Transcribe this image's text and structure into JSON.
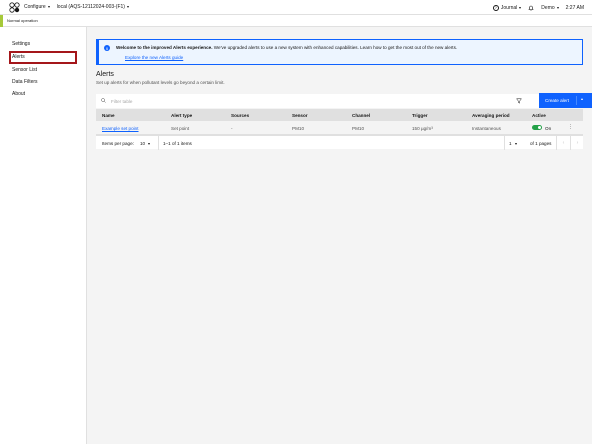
{
  "topbar": {
    "logo": "app-logo",
    "menu_configure": "Configure",
    "menu_device": "local (AQS-12112024-003-(F1)",
    "journal": "Journal",
    "user": "Demo",
    "time": "2:27 AM"
  },
  "status": {
    "text": "Normal operation",
    "accent_color": "#a6c93a"
  },
  "sidebar": {
    "items": [
      {
        "label": "Settings"
      },
      {
        "label": "Alerts"
      },
      {
        "label": "Sensor List"
      },
      {
        "label": "Data Filters"
      },
      {
        "label": "About"
      }
    ],
    "highlight_color": "#a4161a"
  },
  "notice": {
    "title": "Welcome to the improved Alerts experience.",
    "body": "We've upgraded alerts to use a new system with enhanced capabilities. Learn how to get the most out of the new alerts.",
    "link": "Explore the new Alerts guide"
  },
  "alerts": {
    "title": "Alerts",
    "subtitle": "Set up alerts for when pollutant levels go beyond a certain limit.",
    "search_placeholder": "Filter table",
    "create_button": "Create alert",
    "columns": [
      "Name",
      "Alert type",
      "Sources",
      "Sensor",
      "Channel",
      "Trigger",
      "Averaging period",
      "Active"
    ],
    "rows": [
      {
        "name": "Example set point",
        "alert_type": "Set point",
        "sources": "-",
        "sensor": "PM10",
        "channel": "PM10",
        "trigger": "150 µg/m³",
        "averaging_period": "Instantaneous",
        "active": "On"
      }
    ]
  },
  "pagination": {
    "items_per_page_label": "Items per page:",
    "items_per_page": "10",
    "range": "1–1 of 1 items",
    "page": "1",
    "pages": "of 1 pages"
  },
  "colors": {
    "primary": "#0f62fe",
    "toggle_on": "#24a148"
  }
}
